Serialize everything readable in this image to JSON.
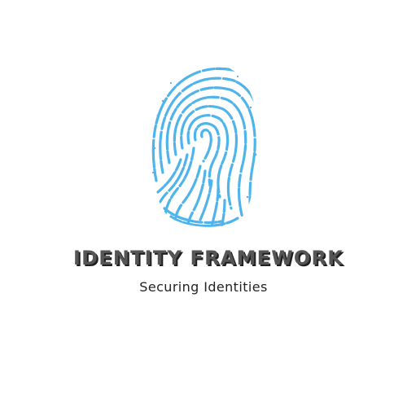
{
  "logo": {
    "icon": "fingerprint-icon",
    "color": "#4fb4ec",
    "title": "IDENTITY FRAMEWORK",
    "tagline": "Securing Identities",
    "title_color": "#555555"
  }
}
